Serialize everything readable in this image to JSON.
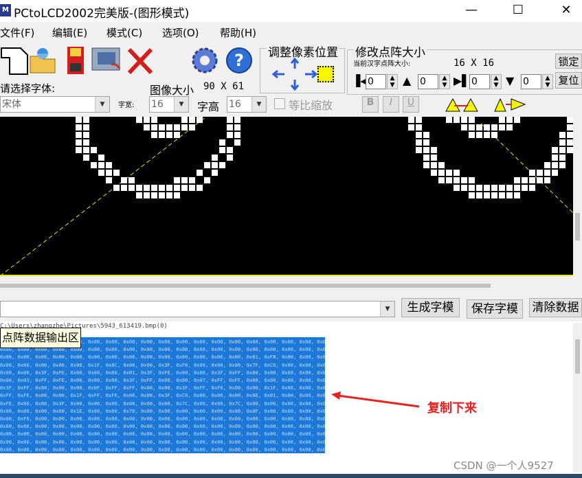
{
  "window": {
    "title": "PCtoLCD2002完美版-(图形模式)",
    "minimize_glyph": "—",
    "maximize_glyph": "☐",
    "close_glyph": "✕"
  },
  "menu": [
    "文件(F)",
    "编辑(E)",
    "模式(C)",
    "选项(O)",
    "帮助(H)"
  ],
  "toolbar": {
    "adjust_group_title": "调整像素位置",
    "dot_group_title": "修改点阵大小",
    "current_size_label": "当前汉字点阵大小:",
    "current_size_value": "16 X 16",
    "lock_button": "锁定",
    "restore_button": "复位",
    "spin_values": [
      "0",
      "0",
      "0",
      "0"
    ]
  },
  "font_row": {
    "select_font_label": "请选择字体:",
    "font_value": "宋体",
    "width_label": "字宽:",
    "width_value": "16",
    "image_size_label": "图像大小",
    "image_size_value": "90 X 61",
    "height_label": "字高",
    "height_value": "16",
    "proportional_label": "等比缩放",
    "bold_label": "B",
    "italic_label": "I",
    "underline_label": "U"
  },
  "output": {
    "generate_button": "生成字模",
    "save_button": "保存字模",
    "clear_button": "清除数据",
    "file_path": "C:\\Users\\zhangzhe\\Pictures\\5943_613419.bmp(0)",
    "tooltip": "点阵数据输出区",
    "hex_lines": [
      "0x00, 0x00, 0x00, 0x00, 0x00, 0x00, 0x00, 0x00, 0x00, 0x00, 0x00, 0x00, 0x00, 0x00, 0x00, 0x00, 0x00, 0x00, 0x00, 0x00,",
      "0x00, 0x00, 0x00, 0x00, 0x00, 0x00, 0x00, 0x00, 0x00, 0x00, 0x00, 0x00, 0x00, 0x00, 0x00, 0x00, 0x00, 0x00, 0x00, 0x00,",
      "0x00, 0x00, 0x00, 0x00, 0x00, 0x00, 0x00, 0x00, 0x00, 0x00, 0x00, 0x00, 0x00, 0x00, 0x01, 0xF8, 0x00, 0x00, 0x0F, 0x00,",
      "0x00, 0x00, 0x00, 0x00, 0x00, 0x1F, 0x8C, 0x00, 0x00, 0x3F, 0xF0, 0x00, 0x00, 0x00, 0x7F, 0xC0, 0x00, 0x00, 0x00, 0x00,",
      "0x00, 0x00, 0x3F, 0xFE, 0x00, 0x00, 0x00, 0x01, 0x3F, 0xFE, 0x00, 0x00, 0x3F, 0xFF, 0x80, 0x00, 0x00, 0x00, 0x00, 0x00,",
      "0x00, 0x03, 0xFF, 0xFE, 0x00, 0x00, 0x00, 0x3F, 0xFF, 0x00, 0x00, 0x07, 0xFF, 0xFF, 0x00, 0x00, 0x00, 0x00, 0x00, 0x00,",
      "0x3F, 0xFF, 0x80, 0x00, 0x00, 0x0F, 0xFF, 0xFF, 0x00, 0x00, 0x3F, 0xFF, 0xF0, 0x00, 0x00, 0x1F, 0x00, 0x00, 0x00, 0x00,",
      "0xFF, 0xFE, 0x00, 0x00, 0x1F, 0xFF, 0xFE, 0x00, 0x00, 0x3F, 0xC0, 0x00, 0x00, 0x00, 0x0E, 0x01, 0x00, 0x00, 0x00, 0x00,",
      "0xFE, 0x00, 0x00, 0x3F, 0x00, 0x00, 0x00, 0x00, 0x00, 0x00, 0x7C, 0x00, 0x00, 0x7C, 0x00, 0x00, 0x00, 0x00, 0x00, 0x00,",
      "0x00, 0x00, 0x00, 0x00, 0x1E, 0x00, 0x00, 0x78, 0x00, 0x00, 0x00, 0x00, 0x00, 0x00, 0x0F, 0x00, 0x00, 0x00, 0x00, 0x00,",
      "0x00, 0xF0, 0x00, 0x00, 0x00, 0x00, 0x00, 0x00, 0x00, 0x00, 0x00, 0x00, 0x00, 0x00, 0x00, 0x00, 0x00, 0x00, 0x00, 0x00,",
      "0x00, 0x00, 0x00, 0x00, 0x00, 0x00, 0x00, 0x00, 0x00, 0x00, 0x00, 0x00, 0x00, 0x00, 0x00, 0x00, 0x00, 0x00, 0x00, 0x00,",
      "0x00, 0x00, 0x00, 0x00, 0x00, 0x00, 0x00, 0x00, 0x00, 0x00, 0x00, 0x00, 0x00, 0x00, 0x00, 0x00, 0x00, 0x00, 0x00, 0x00,",
      "0x00, 0x00, 0x00, 0x00, 0x00, 0x00, 0x00, 0x00, 0x00, 0x00, 0x00, 0x00, 0x00, 0x00, 0x00, 0x00, 0x00, 0x00, 0x00, 0x00,",
      "0x00, 0x00, 0x00, 0x00, 0x00, 0x00, 0x00, 0x00, 0x00, 0x00, 0x00, 0x00, 0x00, 0x00, 0x00, 0x00, 0x00, 0x00, 0x00, 0x00,"
    ],
    "annotation": "复制下来"
  },
  "watermark": "CSDN @一个人9527",
  "colors": {
    "canvas_bg": "#000000",
    "pixel": "#ffffff",
    "guide_line": "#e6e600",
    "selection": "#1e78d7",
    "annotation": "#e8221e"
  }
}
